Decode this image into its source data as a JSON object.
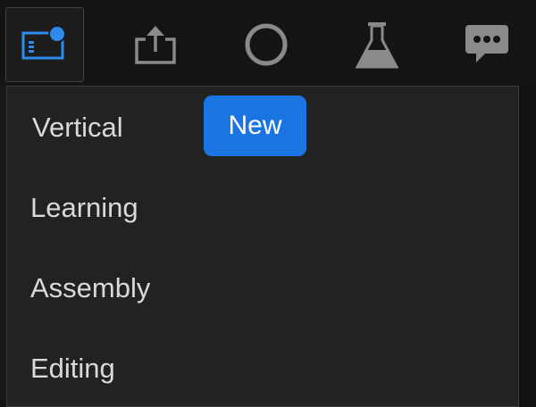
{
  "toolbar": {
    "buttons": [
      {
        "name": "workspaces-icon",
        "active": true
      },
      {
        "name": "share-export-icon",
        "active": false
      },
      {
        "name": "circle-icon",
        "active": false
      },
      {
        "name": "flask-icon",
        "active": false
      },
      {
        "name": "chat-bubble-icon",
        "active": false
      }
    ],
    "icon_color": "#8a8a8a",
    "accent_color": "#1a74e2"
  },
  "workspace_menu": {
    "items": [
      {
        "label": "Vertical",
        "badge": "New"
      },
      {
        "label": "Learning"
      },
      {
        "label": "Assembly"
      },
      {
        "label": "Editing"
      }
    ]
  }
}
